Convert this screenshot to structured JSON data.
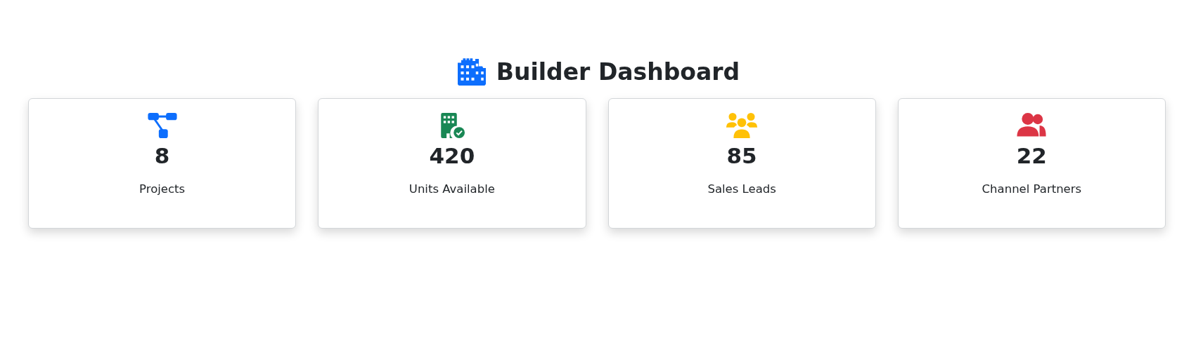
{
  "title": "Builder Dashboard",
  "cards": [
    {
      "kind": "diagram",
      "color": "#0d6efd",
      "value": "8",
      "label": "Projects"
    },
    {
      "kind": "building",
      "color": "#198754",
      "value": "420",
      "label": "Units Available"
    },
    {
      "kind": "group",
      "color": "#ffc107",
      "value": "85",
      "label": "Sales Leads"
    },
    {
      "kind": "people",
      "color": "#dc3545",
      "value": "22",
      "label": "Channel Partners"
    }
  ]
}
